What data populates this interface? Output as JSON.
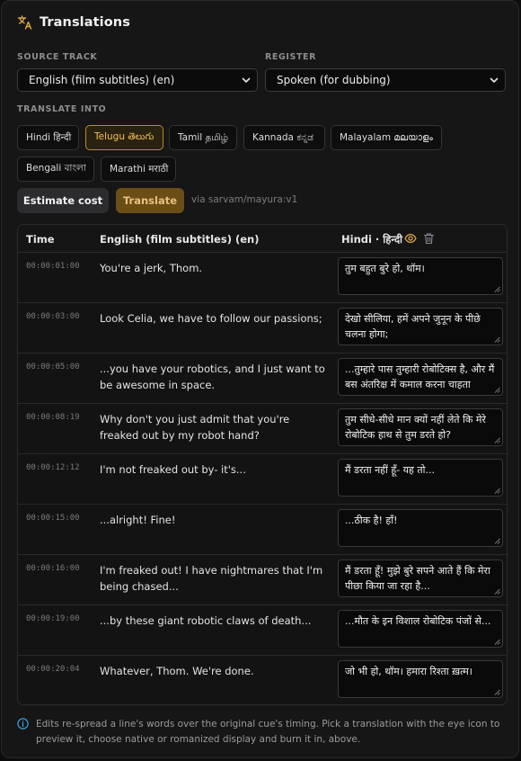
{
  "header": {
    "title": "Translations"
  },
  "source_track": {
    "label": "SOURCE TRACK",
    "value": "English (film subtitles) (en)"
  },
  "register": {
    "label": "REGISTER",
    "value": "Spoken (for dubbing)"
  },
  "translate_into": {
    "label": "TRANSLATE INTO",
    "languages": [
      {
        "label": "Hindi हिन्दी",
        "active": false
      },
      {
        "label": "Telugu తెలుగు",
        "active": true
      },
      {
        "label": "Tamil தமிழ்",
        "active": false
      },
      {
        "label": "Kannada ಕನ್ನಡ",
        "active": false
      },
      {
        "label": "Malayalam മലയാളം",
        "active": false
      },
      {
        "label": "Bengali বাংলা",
        "active": false
      },
      {
        "label": "Marathi मराठी",
        "active": false
      }
    ]
  },
  "actions": {
    "estimate_label": "Estimate cost",
    "translate_label": "Translate",
    "via_text": "via sarvam/mayura:v1"
  },
  "table": {
    "columns": {
      "time": "Time",
      "source": "English (film subtitles) (en)",
      "target": "Hindi · हिन्दी"
    },
    "rows": [
      {
        "time": "00:00:01:00",
        "source": "You're a jerk, Thom.",
        "target": "तुम बहुत बुरे हो, थॉम।"
      },
      {
        "time": "00:00:03:00",
        "source": "Look Celia, we have to follow our passions;",
        "target": "देखो सीलिया, हमें अपने जुनून के पीछे चलना होगा;"
      },
      {
        "time": "00:00:05:00",
        "source": "...you have your robotics, and I just want to be awesome in space.",
        "target": "...तुम्हारे पास तुम्हारी रोबोटिक्स है, और मैं बस अंतरिक्ष में कमाल करना चाहता"
      },
      {
        "time": "00:00:08:19",
        "source": "Why don't you just admit that you're freaked out by my robot hand?",
        "target": "तुम सीधे-सीधे मान क्यों नहीं लेते कि मेरे रोबोटिक हाथ से तुम डरते हो?"
      },
      {
        "time": "00:00:12:12",
        "source": "I'm not freaked out by- it's...",
        "target": "मैं डरता नहीं हूँ- यह तो..."
      },
      {
        "time": "00:00:15:00",
        "source": "...alright! Fine!",
        "target": "...ठीक है! हाँ!"
      },
      {
        "time": "00:00:16:00",
        "source": "I'm freaked out! I have nightmares that I'm being chased...",
        "target": "मैं डरता हूँ! मुझे बुरे सपने आते हैं कि मेरा पीछा किया जा रहा है..."
      },
      {
        "time": "00:00:19:00",
        "source": "...by these giant robotic claws of death...",
        "target": "...मौत के इन विशाल रोबोटिक पंजों से..."
      },
      {
        "time": "00:00:20:04",
        "source": "Whatever, Thom. We're done.",
        "target": "जो भी हो, थॉम। हमारा रिश्ता ख़त्म।"
      }
    ]
  },
  "footnote": "Edits re-spread a line's words over the original cue's timing. Pick a translation with the eye icon to preview it, choose native or romanized display and burn it in, above.",
  "colors": {
    "accent": "#f1c153",
    "panel": "#161617",
    "translate_button": "#6b4d16"
  },
  "icons": [
    "translate-icon",
    "chevron-down-icon",
    "eye-icon",
    "trash-icon",
    "info-icon"
  ]
}
